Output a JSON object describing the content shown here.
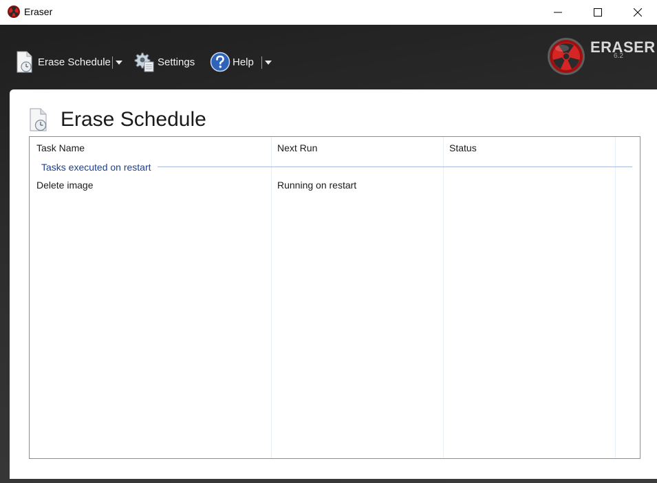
{
  "window": {
    "title": "Eraser"
  },
  "toolbar": {
    "erase_schedule_label": "Erase Schedule",
    "settings_label": "Settings",
    "help_label": "Help"
  },
  "brand": {
    "name": "ERASER",
    "version": "6.2"
  },
  "page": {
    "title": "Erase Schedule"
  },
  "list": {
    "columns": [
      "Task Name",
      "Next Run",
      "Status"
    ],
    "groups": [
      {
        "label": "Tasks executed on restart",
        "rows": [
          {
            "task_name": "Delete image",
            "next_run": "Running on restart",
            "status": ""
          }
        ]
      }
    ]
  },
  "colors": {
    "group_text": "#1e3f8c",
    "frame_dark": "#2d2d2d",
    "accent_red": "#c8102e"
  }
}
